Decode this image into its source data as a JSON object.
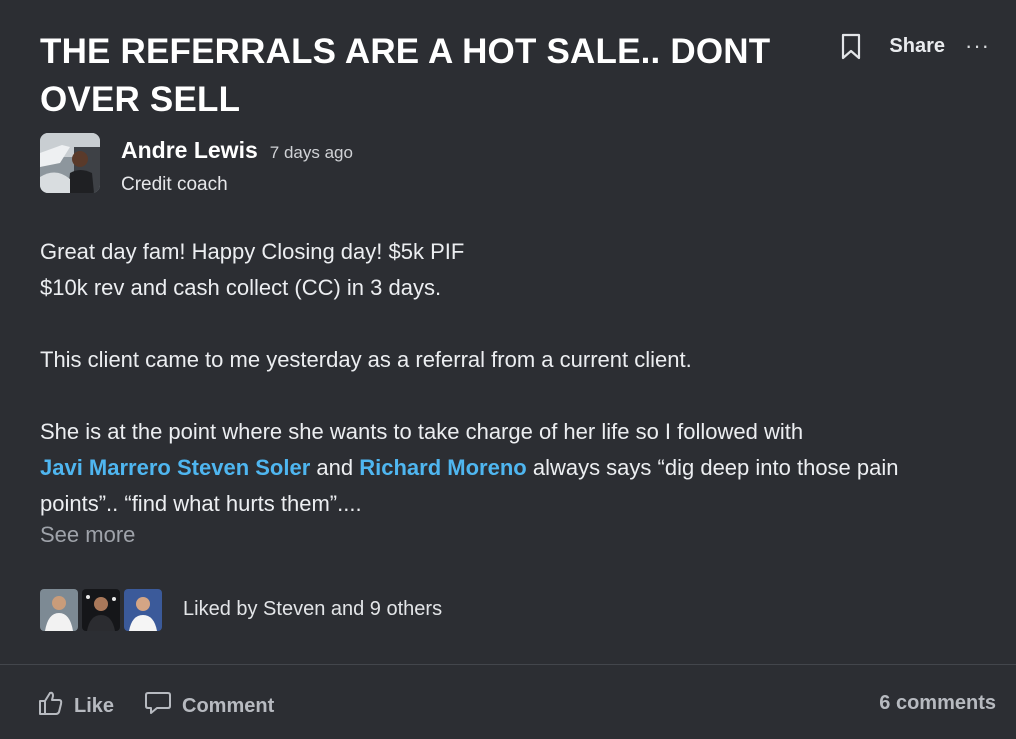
{
  "post": {
    "title_line1": "THE REFERRALS ARE A HOT SALE.. DONT",
    "title_line2": "OVER SELL",
    "share_label": "Share",
    "more_label": "···",
    "author": {
      "name": "Andre Lewis",
      "timestamp": "7 days ago",
      "role": "Credit coach"
    },
    "body": {
      "line1": "Great day fam! Happy Closing day! $5k PIF",
      "line2": "$10k rev and cash collect (CC) in 3 days.",
      "line3": "This client came to me yesterday as a referral from a current client.",
      "line4": "She is at the point where she wants to take charge of her life so I followed with",
      "mention1": "Javi Marrero",
      "mention2": "Steven Soler",
      "and_text": "and",
      "mention3": "Richard Moreno",
      "line5_rest": "always says “dig deep into those pain",
      "line6": "points”.. “find what hurts them”...."
    },
    "see_more": "See more",
    "liked_by": "Liked by Steven and 9 others",
    "footer": {
      "like_label": "Like",
      "comment_label": "Comment",
      "comments_count": "6 comments"
    }
  },
  "colors": {
    "background": "#2c2e33",
    "mention": "#4fb6f0",
    "muted": "#9fa3aa"
  },
  "icons": [
    "bookmark-icon",
    "more-icon",
    "thumbs-up-icon",
    "comment-icon"
  ]
}
